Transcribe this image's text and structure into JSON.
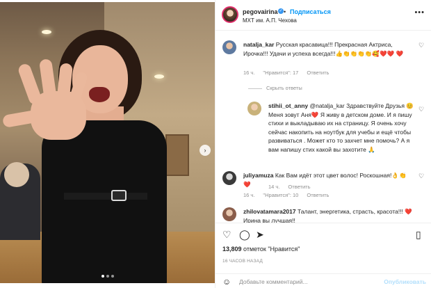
{
  "post": {
    "username": "pegovairina",
    "follow_label": "Подписаться",
    "dot": "•",
    "location": "МХТ им. А.П. Чехова",
    "more_icon": "more-icon"
  },
  "comments": [
    {
      "username": "natalja_kar",
      "text": "Русская красавица!!! Прекрасная Актриса, Ирочка!!! Удачи и успеха всегда!!!👍👏👏👏👏🥰❤️❤️",
      "text_extra": "❤️",
      "time": "16 ч.",
      "likes": "\"Нравится\": 17",
      "reply": "Ответить"
    },
    {
      "hide_replies": "Скрыть ответы"
    },
    {
      "username": "stihii_ot_anny",
      "text": "@natalja_kar Здравствуйте Друзья 😊 Меня зовут Аня❤️ Я живу в детском доме. И я пишу стихи и выкладываю их на страницу. Я очень хочу сейчас накопить на ноутбук для учебы и ещё чтобы развиваться . Может кто то захчет мне помочь? А я вам напишу стих какой вы захотите 🙏",
      "time": "14 ч.",
      "reply": "Ответить"
    },
    {
      "username": "juliyamuza",
      "text": "Как Вам идёт этот цвет волос! Роскошная!👌👏",
      "text_extra": "❤️",
      "time": "16 ч.",
      "likes": "\"Нравится\": 10",
      "reply": "Ответить"
    },
    {
      "username": "zhilovatamara2017",
      "text": "Талант, энергетика, страсть, красота!!! ❤️",
      "text_extra": "Ирина вы лучшая!!",
      "time": "",
      "reply": ""
    }
  ],
  "actions": {
    "likes_count": "13,809",
    "likes_suffix": "отметок \"Нравится\"",
    "time_ago": "16 ЧАСОВ НАЗАД",
    "comment_placeholder": "Добавьте комментарий...",
    "publish_label": "Опубликовать"
  },
  "photo": {
    "next_icon": "chevron-right-icon",
    "dots_total": 3,
    "dots_active": 1
  }
}
